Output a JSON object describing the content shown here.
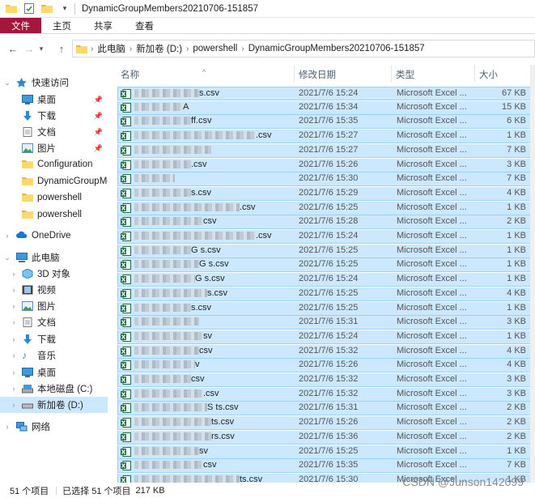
{
  "window": {
    "title": "DynamicGroupMembers20210706-151857"
  },
  "ribbon": {
    "tabs": [
      "文件",
      "主页",
      "共享",
      "查看"
    ]
  },
  "breadcrumb": [
    "此电脑",
    "新加卷 (D:)",
    "powershell",
    "DynamicGroupMembers20210706-151857"
  ],
  "sidebar": {
    "items": [
      {
        "label": "快速访问",
        "icon": "star-icon"
      },
      {
        "label": "桌面",
        "icon": "desktop-icon"
      },
      {
        "label": "下载",
        "icon": "download-icon"
      },
      {
        "label": "文档",
        "icon": "document-icon"
      },
      {
        "label": "图片",
        "icon": "pictures-icon"
      },
      {
        "label": "Configuration",
        "icon": "folder-icon"
      },
      {
        "label": "DynamicGroupMe",
        "icon": "folder-icon"
      },
      {
        "label": "powershell",
        "icon": "folder-icon"
      },
      {
        "label": "powershell",
        "icon": "folder-icon"
      },
      {
        "label": "OneDrive",
        "icon": "cloud-icon"
      },
      {
        "label": "此电脑",
        "icon": "pc-icon"
      },
      {
        "label": "3D 对象",
        "icon": "cube-icon"
      },
      {
        "label": "视频",
        "icon": "video-icon"
      },
      {
        "label": "图片",
        "icon": "pictures-icon"
      },
      {
        "label": "文档",
        "icon": "document-icon"
      },
      {
        "label": "下载",
        "icon": "download-icon"
      },
      {
        "label": "音乐",
        "icon": "music-icon"
      },
      {
        "label": "桌面",
        "icon": "desktop-icon"
      },
      {
        "label": "本地磁盘 (C:)",
        "icon": "drive-icon"
      },
      {
        "label": "新加卷 (D:)",
        "icon": "drive-icon"
      },
      {
        "label": "网络",
        "icon": "network-icon"
      }
    ]
  },
  "columns": {
    "name": "名称",
    "date": "修改日期",
    "type": "类型",
    "size": "大小"
  },
  "files": [
    {
      "name": "s.csv",
      "date": "2021/7/6 15:24",
      "type": "Microsoft Excel ...",
      "size": "67 KB"
    },
    {
      "name": "A",
      "date": "2021/7/6 15:34",
      "type": "Microsoft Excel ...",
      "size": "15 KB"
    },
    {
      "name": "ff.csv",
      "date": "2021/7/6 15:35",
      "type": "Microsoft Excel ...",
      "size": "6 KB"
    },
    {
      "name": ".csv",
      "date": "2021/7/6 15:27",
      "type": "Microsoft Excel ...",
      "size": "1 KB"
    },
    {
      "name": "",
      "date": "2021/7/6 15:27",
      "type": "Microsoft Excel ...",
      "size": "7 KB"
    },
    {
      "name": ".csv",
      "date": "2021/7/6 15:26",
      "type": "Microsoft Excel ...",
      "size": "3 KB"
    },
    {
      "name": "",
      "date": "2021/7/6 15:30",
      "type": "Microsoft Excel ...",
      "size": "7 KB"
    },
    {
      "name": "s.csv",
      "date": "2021/7/6 15:29",
      "type": "Microsoft Excel ...",
      "size": "4 KB"
    },
    {
      "name": ".csv",
      "date": "2021/7/6 15:25",
      "type": "Microsoft Excel ...",
      "size": "1 KB"
    },
    {
      "name": "csv",
      "date": "2021/7/6 15:28",
      "type": "Microsoft Excel ...",
      "size": "2 KB"
    },
    {
      "name": ".csv",
      "date": "2021/7/6 15:24",
      "type": "Microsoft Excel ...",
      "size": "1 KB"
    },
    {
      "name": "G s.csv",
      "date": "2021/7/6 15:25",
      "type": "Microsoft Excel ...",
      "size": "1 KB"
    },
    {
      "name": "G s.csv",
      "date": "2021/7/6 15:25",
      "type": "Microsoft Excel ...",
      "size": "1 KB"
    },
    {
      "name": "G s.csv",
      "date": "2021/7/6 15:24",
      "type": "Microsoft Excel ...",
      "size": "1 KB"
    },
    {
      "name": "s.csv",
      "date": "2021/7/6 15:25",
      "type": "Microsoft Excel ...",
      "size": "4 KB"
    },
    {
      "name": "s.csv",
      "date": "2021/7/6 15:25",
      "type": "Microsoft Excel ...",
      "size": "1 KB"
    },
    {
      "name": "",
      "date": "2021/7/6 15:31",
      "type": "Microsoft Excel ...",
      "size": "3 KB"
    },
    {
      "name": "sv",
      "date": "2021/7/6 15:24",
      "type": "Microsoft Excel ...",
      "size": "1 KB"
    },
    {
      "name": "csv",
      "date": "2021/7/6 15:32",
      "type": "Microsoft Excel ...",
      "size": "4 KB"
    },
    {
      "name": "v",
      "date": "2021/7/6 15:26",
      "type": "Microsoft Excel ...",
      "size": "4 KB"
    },
    {
      "name": "csv",
      "date": "2021/7/6 15:32",
      "type": "Microsoft Excel ...",
      "size": "3 KB"
    },
    {
      "name": ".csv",
      "date": "2021/7/6 15:32",
      "type": "Microsoft Excel ...",
      "size": "3 KB"
    },
    {
      "name": "S ts.csv",
      "date": "2021/7/6 15:31",
      "type": "Microsoft Excel ...",
      "size": "2 KB"
    },
    {
      "name": "ts.csv",
      "date": "2021/7/6 15:26",
      "type": "Microsoft Excel ...",
      "size": "2 KB"
    },
    {
      "name": "rs.csv",
      "date": "2021/7/6 15:36",
      "type": "Microsoft Excel ...",
      "size": "2 KB"
    },
    {
      "name": "sv",
      "date": "2021/7/6 15:25",
      "type": "Microsoft Excel ...",
      "size": "1 KB"
    },
    {
      "name": "csv",
      "date": "2021/7/6 15:35",
      "type": "Microsoft Excel ...",
      "size": "7 KB"
    },
    {
      "name": "ts.csv",
      "date": "2021/7/6 15:30",
      "type": "Microsoft Excel ...",
      "size": "1 KB"
    }
  ],
  "status": {
    "count": "51 个项目",
    "selected": "已选择 51 个项目",
    "size": "217 KB"
  },
  "watermark": "CSDN @Junson142099",
  "colors": {
    "file_tab": "#a2173b",
    "selection": "#cce8ff",
    "selection_border": "#99d1ff",
    "excel": "#1d7044"
  }
}
